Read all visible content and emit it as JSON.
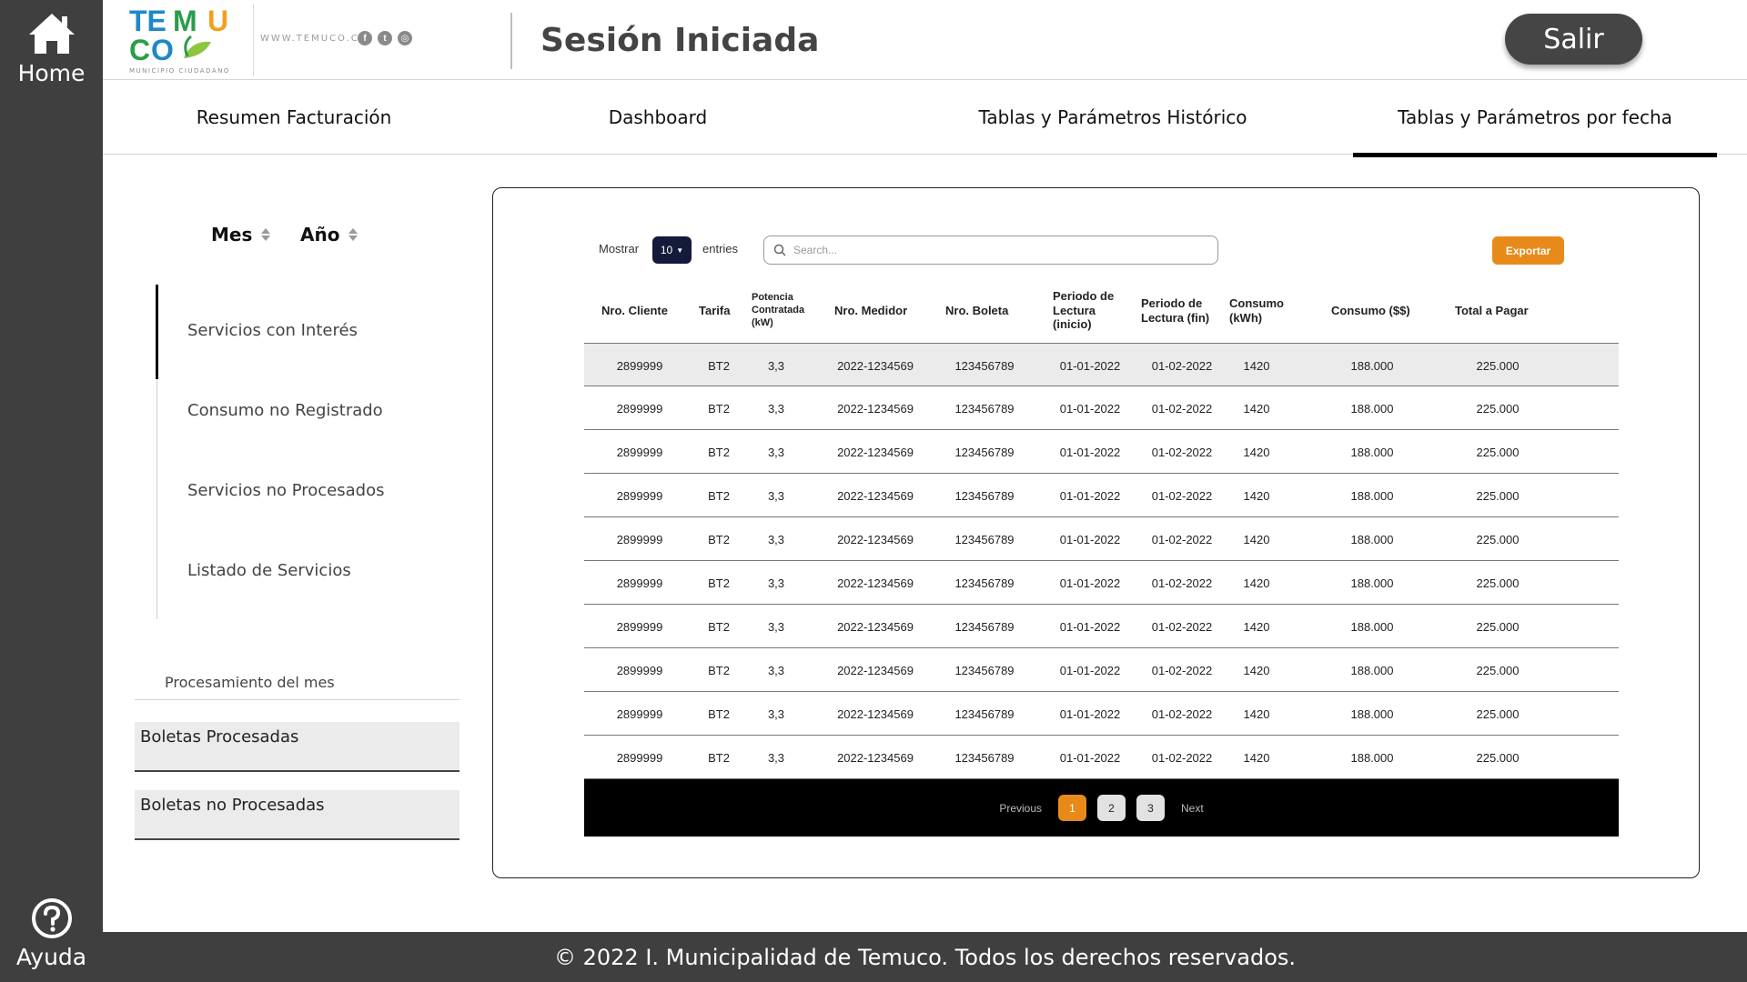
{
  "rail": {
    "home_label": "Home",
    "help_label": "Ayuda"
  },
  "header": {
    "logo_text": "TEMUCO",
    "logo_subtext": "MUNICIPIO CIUDADANO",
    "website": "WWW.TEMUCO.CL",
    "title": "Sesión Iniciada",
    "logout_label": "Salir",
    "social_icons": [
      "facebook-icon",
      "twitter-icon",
      "instagram-icon"
    ]
  },
  "tabs": [
    {
      "label": "Resumen Facturación",
      "active": false
    },
    {
      "label": "Dashboard",
      "active": false
    },
    {
      "label": "Tablas y Parámetros Histórico",
      "active": false
    },
    {
      "label": "Tablas y Parámetros por fecha",
      "active": true
    }
  ],
  "filters": {
    "month_label": "Mes",
    "year_label": "Año"
  },
  "side_nav": {
    "items": [
      {
        "label": "Servicios con Interés",
        "active": true
      },
      {
        "label": "Consumo no Registrado",
        "active": false
      },
      {
        "label": "Servicios no Procesados",
        "active": false
      },
      {
        "label": "Listado de Servicios",
        "active": false
      }
    ]
  },
  "processing": {
    "title": "Procesamiento del mes",
    "processed_label": "Boletas Procesadas",
    "unprocessed_label": "Boletas no Procesadas"
  },
  "table_controls": {
    "show_label": "Mostrar",
    "entries_value": "10",
    "entries_label": "entries",
    "search_placeholder": "Search...",
    "export_label": "Exportar"
  },
  "table": {
    "headers": [
      "Nro. Cliente",
      "Tarifa",
      "Potencia Contratada (kW)",
      "Nro. Medidor",
      "Nro. Boleta",
      "Periodo de Lectura (inicio)",
      "Periodo de Lectura (fin)",
      "Consumo (kWh)",
      "Consumo ($$)",
      "Total a Pagar"
    ],
    "rows": [
      [
        "2899999",
        "BT2",
        "3,3",
        "2022-1234569",
        "123456789",
        "01-01-2022",
        "01-02-2022",
        "1420",
        "188.000",
        "225.000"
      ],
      [
        "2899999",
        "BT2",
        "3,3",
        "2022-1234569",
        "123456789",
        "01-01-2022",
        "01-02-2022",
        "1420",
        "188.000",
        "225.000"
      ],
      [
        "2899999",
        "BT2",
        "3,3",
        "2022-1234569",
        "123456789",
        "01-01-2022",
        "01-02-2022",
        "1420",
        "188.000",
        "225.000"
      ],
      [
        "2899999",
        "BT2",
        "3,3",
        "2022-1234569",
        "123456789",
        "01-01-2022",
        "01-02-2022",
        "1420",
        "188.000",
        "225.000"
      ],
      [
        "2899999",
        "BT2",
        "3,3",
        "2022-1234569",
        "123456789",
        "01-01-2022",
        "01-02-2022",
        "1420",
        "188.000",
        "225.000"
      ],
      [
        "2899999",
        "BT2",
        "3,3",
        "2022-1234569",
        "123456789",
        "01-01-2022",
        "01-02-2022",
        "1420",
        "188.000",
        "225.000"
      ],
      [
        "2899999",
        "BT2",
        "3,3",
        "2022-1234569",
        "123456789",
        "01-01-2022",
        "01-02-2022",
        "1420",
        "188.000",
        "225.000"
      ],
      [
        "2899999",
        "BT2",
        "3,3",
        "2022-1234569",
        "123456789",
        "01-01-2022",
        "01-02-2022",
        "1420",
        "188.000",
        "225.000"
      ],
      [
        "2899999",
        "BT2",
        "3,3",
        "2022-1234569",
        "123456789",
        "01-01-2022",
        "01-02-2022",
        "1420",
        "188.000",
        "225.000"
      ],
      [
        "2899999",
        "BT2",
        "3,3",
        "2022-1234569",
        "123456789",
        "01-01-2022",
        "01-02-2022",
        "1420",
        "188.000",
        "225.000"
      ]
    ]
  },
  "pagination": {
    "previous_label": "Previous",
    "next_label": "Next",
    "pages": [
      "1",
      "2",
      "3"
    ],
    "current_page": "1"
  },
  "footer": {
    "text": "© 2022 I. Municipalidad de Temuco. Todos los derechos reservados."
  },
  "colors": {
    "rail": "#3f3f3f",
    "accent_orange": "#e88a1a",
    "entries_select": "#131a3a",
    "pager_bg": "#000000"
  }
}
